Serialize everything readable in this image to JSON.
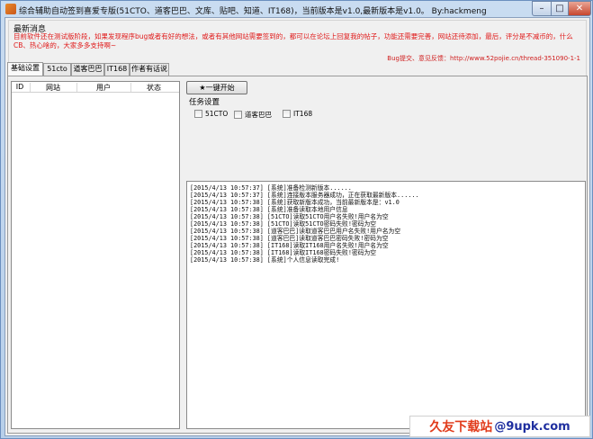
{
  "window": {
    "title": "综合辅助自动签到喜爱专版(51CTO、道客巴巴、文库、贴吧、知道、IT168)，当前版本是v1.0,最新版本是v1.0。 By:hackmeng"
  },
  "news": {
    "title": "最新消息",
    "body": "目前软件还在测试版阶段，如果发现程序bug或者有好的想法，或者有其他网站需要签到的，都可以在论坛上回复我的帖子，功能还需要完善，网站还待添加，最后，评分是不减币的，什么CB、热心啥的，大家多多支持啊~",
    "link_text": "Bug提交、意见反馈：http://www.52pojie.cn/thread-351090-1-1"
  },
  "tabs": [
    {
      "label": "基础设置"
    },
    {
      "label": "51cto"
    },
    {
      "label": "道客巴巴"
    },
    {
      "label": "IT168"
    },
    {
      "label": "作者有话说"
    }
  ],
  "accounts_table": {
    "columns": [
      "ID",
      "网站",
      "用户",
      "状态"
    ],
    "rows": []
  },
  "start_button": {
    "label": "★一键开始"
  },
  "task_settings": {
    "label": "任务设置",
    "options": [
      {
        "label": "51CTO",
        "checked": false
      },
      {
        "label": "道客巴巴",
        "checked": false
      },
      {
        "label": "IT168",
        "checked": false
      }
    ]
  },
  "log": [
    "[2015/4/13 10:57:37] [系统]准备检测新版本......",
    "[2015/4/13 10:57:37] [系统]连接版本服务器成功，正在获取最新版本......",
    "[2015/4/13 10:57:38] [系统]获取新版本成功，当前最新版本是：v1.0",
    "[2015/4/13 10:57:38] [系统]准备读取本地用户信息",
    "[2015/4/13 10:57:38] [51CTO]读取51CTO用户名失败!用户名为空",
    "[2015/4/13 10:57:38] [51CTO]读取51CTO密码失败!密码为空",
    "[2015/4/13 10:57:38] [道客巴巴]读取道客巴巴用户名失败!用户名为空",
    "[2015/4/13 10:57:38] [道客巴巴]读取道客巴巴密码失败!密码为空",
    "[2015/4/13 10:57:38] [IT168]读取IT168用户名失败!用户名为空",
    "[2015/4/13 10:57:38] [IT168]读取IT168密码失败!密码为空",
    "[2015/4/13 10:57:38] [系统]个人信息读取完成!"
  ],
  "watermark": {
    "text_cn": "久友下载站",
    "text_url": "@9upk.com"
  }
}
